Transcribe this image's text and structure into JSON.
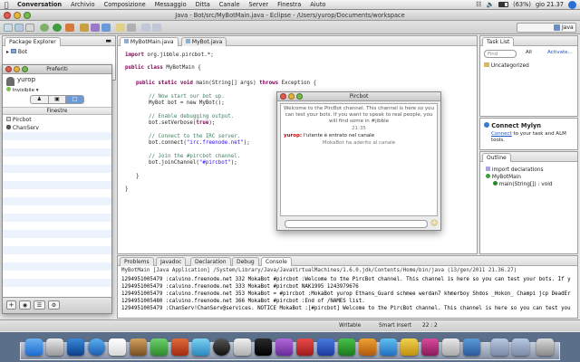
{
  "menubar": {
    "app": "Conversation",
    "items": [
      "Archivio",
      "Composizione",
      "Messaggio",
      "Ditta",
      "Canale",
      "Server",
      "Finestra",
      "Aiuto"
    ],
    "battery": "(63%)",
    "clock": "gio 21.37"
  },
  "window": {
    "title": "Java - Bot/src/MyBotMain.java - Eclipse - /Users/yurop/Documents/workspace"
  },
  "perspective": {
    "label": "Java"
  },
  "package_explorer": {
    "tab": "Package Explorer",
    "tree_item": "Bot"
  },
  "buddy": {
    "title": "Preferiti",
    "user": "yurop",
    "status": "Invisibile",
    "section": "Finestre",
    "items": [
      "Pircbot",
      "ChanServ"
    ]
  },
  "editor": {
    "tabs": [
      "MyBotMain.java",
      "MyBot.java"
    ],
    "lines": {
      "import_kw": "import",
      "import_rest": " org.jibble.pircbot.*;",
      "class_kw": "public class",
      "class_rest": " MyBotMain {",
      "main_kw": "public static void",
      "main_rest": " main(String[] args) ",
      "throws_kw": "throws",
      "throws_rest": " Exception {",
      "c1": "// Now start our bot up.",
      "s1": "MyBot bot = new MyBot();",
      "c2": "// Enable debugging output.",
      "s2a": "bot.setVerbose(",
      "s2b": "true",
      "s2c": ");",
      "c3": "// Connect to the IRC server.",
      "s3a": "bot.connect(",
      "s3b": "\"irc.freenode.net\"",
      "s3c": ");",
      "c4": "// Join the #pircbot channel.",
      "s4a": "bot.joinChannel(",
      "s4b": "\"#pircbot\"",
      "s4c": ");",
      "close1": "}",
      "close2": "}"
    }
  },
  "chat": {
    "title": "Pircbot",
    "welcome": "Welcome to the PircBot channel. This channel is here so you can test your bots. If you want to speak to real people, you will find some in #jibble",
    "time": "21:35",
    "nick": "yurop:",
    "message": " l'utente è entrato nel canale",
    "event": "MokaBot ha aderito al canale"
  },
  "task_list": {
    "tab": "Task List",
    "find_placeholder": "Find",
    "all": "All",
    "activate": "Activate...",
    "category": "Uncategorized"
  },
  "mylyn": {
    "title": "Connect Mylyn",
    "link": "Connect",
    "text": " to your task and ALM tools."
  },
  "outline": {
    "tab": "Outline",
    "items": [
      "import declarations",
      "MyBotMain",
      "main(String[]) : void"
    ]
  },
  "console": {
    "tabs": [
      "Problems",
      "Javadoc",
      "Declaration",
      "Debug",
      "Console"
    ],
    "header": "MyBotMain [Java Application] /System/Library/Java/JavaVirtualMachines/1.6.0.jdk/Contents/Home/bin/java (13/gen/2011 21.36.27)",
    "lines": [
      "1294951005479 :calvino.freenode.net 332 MokaBot #pircbot :Welcome to the PircBot channel. This channel is here so you can test your bots. If y",
      "1294951005479 :calvino.freenode.net 333 MokaBot #pircbot NAK1995 1243979676",
      "1294951005479 :calvino.freenode.net 353 MokaBot = #pircbot :MokaBot yurop Ethans_Guard schmee werdan7 khmerboy Shdos _Hokon_ Champi jcp DeadEr",
      "1294951005480 :calvino.freenode.net 366 MokaBot #pircbot :End of /NAMES list.",
      "1294951005479 :ChanServ!ChanServ@services. NOTICE MokaBot :[#pircbot] Welcome to the PircBot channel. This channel is here so you can test you"
    ]
  },
  "statusbar": {
    "mode": "Writable",
    "insert": "Smart Insert",
    "position": "22 : 2"
  },
  "colors": {
    "keyword": "#7f0055",
    "comment": "#3f7f5f",
    "string": "#2a00ff",
    "nick": "#cc0000",
    "link": "#1a55c9"
  }
}
